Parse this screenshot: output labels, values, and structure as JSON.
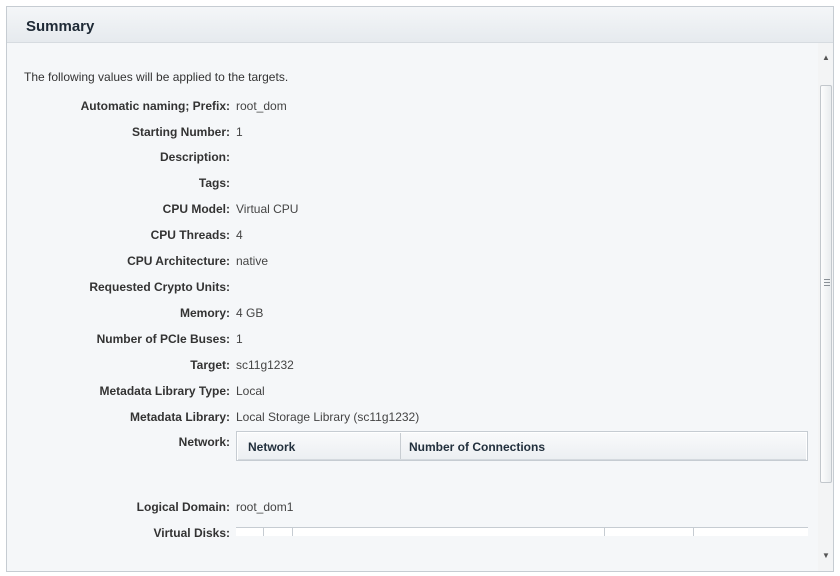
{
  "header": {
    "title": "Summary"
  },
  "intro": "The following values will be applied to the targets.",
  "fields": [
    {
      "label": "Automatic naming; Prefix:",
      "value": "root_dom"
    },
    {
      "label": "Starting Number:",
      "value": "1"
    },
    {
      "label": "Description:",
      "value": ""
    },
    {
      "label": "Tags:",
      "value": ""
    },
    {
      "label": "CPU Model:",
      "value": "Virtual CPU"
    },
    {
      "label": "CPU Threads:",
      "value": "4"
    },
    {
      "label": "CPU Architecture:",
      "value": "native"
    },
    {
      "label": "Requested Crypto Units:",
      "value": ""
    },
    {
      "label": "Memory:",
      "value": "4 GB"
    },
    {
      "label": "Number of PCIe Buses:",
      "value": "1"
    },
    {
      "label": "Target:",
      "value": "sc11g1232"
    },
    {
      "label": "Metadata Library Type:",
      "value": "Local"
    },
    {
      "label": "Metadata Library:",
      "value": "Local Storage Library (sc11g1232)"
    },
    {
      "label": "Network:",
      "value": ""
    },
    {
      "label": "Logical Domain:",
      "value": "root_dom1"
    },
    {
      "label": "Virtual Disks:",
      "value": ""
    }
  ],
  "network_table": {
    "columns": [
      "Network",
      "Number of Connections"
    ]
  },
  "scrollbar": {
    "up_icon": "arrow-up-icon",
    "down_icon": "arrow-down-icon",
    "grip_icon": "grip-icon"
  }
}
